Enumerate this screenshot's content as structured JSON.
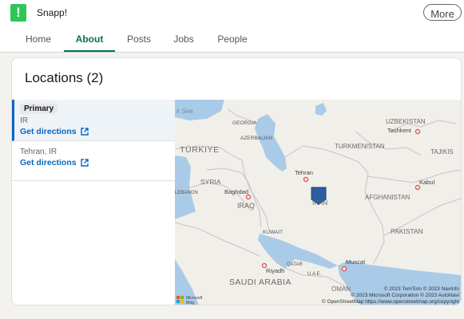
{
  "company": {
    "name": "Snapp!",
    "logo_glyph": "!"
  },
  "header": {
    "more_label": "More"
  },
  "tabs": [
    {
      "label": "Home"
    },
    {
      "label": "About"
    },
    {
      "label": "Posts"
    },
    {
      "label": "Jobs"
    },
    {
      "label": "People"
    }
  ],
  "active_tab": "About",
  "locations": {
    "title": "Locations (2)",
    "items": [
      {
        "badge": "Primary",
        "address": "IR",
        "directions_label": "Get directions"
      },
      {
        "badge": "",
        "address": "Tehran, IR",
        "directions_label": "Get directions"
      }
    ]
  },
  "map": {
    "labels": {
      "sea": "k Sea",
      "georgia": "GEORGIA",
      "azerbaijan": "AZERBAIJAN",
      "turkiye": "TÜRKIYE",
      "syria": "SYRIA",
      "lebanon": "LEBANON",
      "iraq": "IRAQ",
      "baghdad": "Baghdad",
      "tehran": "Tehran",
      "iran": "IRAN",
      "turkmenistan": "TURKMENISTAN",
      "uzbekistan": "UZBEKISTAN",
      "tashkent": "Tashkent",
      "tajikistan": "TAJIKIS",
      "afghanistan": "AFGHANISTAN",
      "kabul": "Kabul",
      "pakistan": "PAKISTAN",
      "kuwait": "KUWAIT",
      "saudi": "SAUDI ARABIA",
      "riyadh": "Riyadh",
      "qatar": "QATAR",
      "uae": "U.A.E.",
      "muscat": "Muscat",
      "oman": "OMAN",
      "ms_name": "Microsoft",
      "ms_bing": "Bing"
    },
    "copyright": [
      "© 2023 TomTom © 2023 NavInfo",
      "© 2023 Microsoft Corporation © 2023 AutoNavi",
      "© OpenStreetMap  https://www.openstreetmap.org/copyright"
    ],
    "colors": {
      "water": "#aacbe8",
      "land": "#f1efe9",
      "border": "#c7c2c9",
      "pin": "#2a5fa2",
      "city": "#e05a5a"
    }
  }
}
